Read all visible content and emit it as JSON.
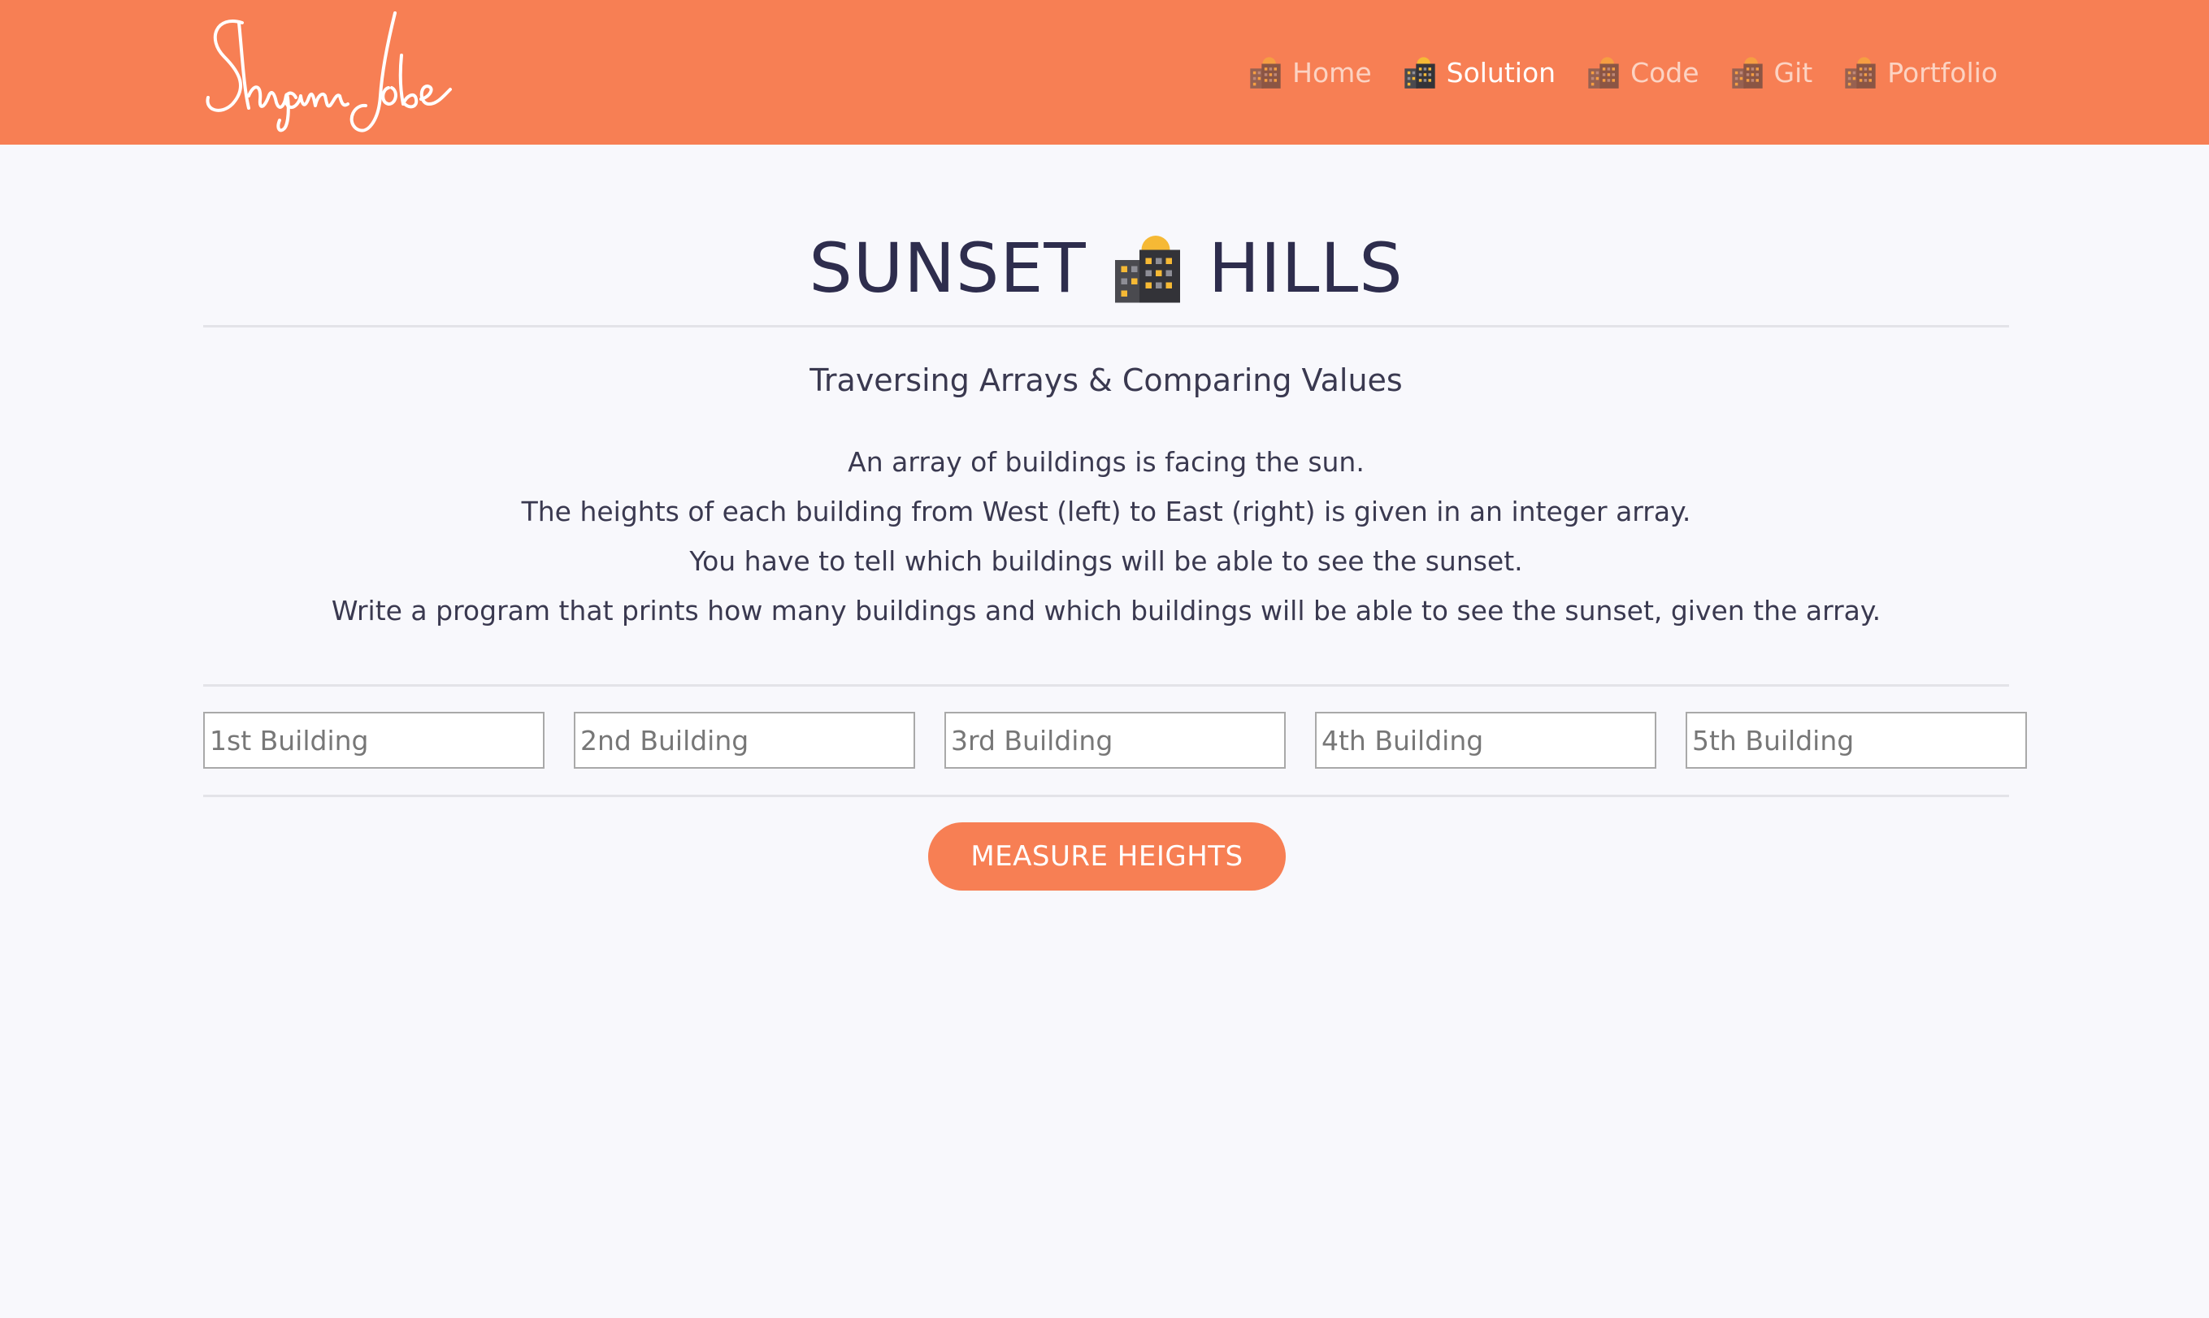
{
  "brand": {
    "logo_alt": "Shyann Jobe"
  },
  "nav": {
    "items": [
      {
        "label": "Home",
        "active": false
      },
      {
        "label": "Solution",
        "active": true
      },
      {
        "label": "Code",
        "active": false
      },
      {
        "label": "Git",
        "active": false
      },
      {
        "label": "Portfolio",
        "active": false
      }
    ]
  },
  "page": {
    "title_left": "SUNSET",
    "title_icon": "city-sunset-icon",
    "title_right": "HILLS",
    "subtitle": "Traversing Arrays & Comparing Values",
    "description": [
      "An array of buildings is facing the sun.",
      "The heights of each building from West (left) to East (right) is given in an integer array.",
      "You have to tell which buildings will be able to see the sunset.",
      "Write a program that prints how many buildings and which buildings will be able to see the sunset, given the array."
    ]
  },
  "inputs": [
    {
      "placeholder": "1st Building",
      "value": ""
    },
    {
      "placeholder": "2nd Building",
      "value": ""
    },
    {
      "placeholder": "3rd Building",
      "value": ""
    },
    {
      "placeholder": "4th Building",
      "value": ""
    },
    {
      "placeholder": "5th Building",
      "value": ""
    }
  ],
  "button": {
    "label": "MEASURE HEIGHTS"
  },
  "colors": {
    "accent": "#f77f54",
    "text": "#2e2d4d",
    "background": "#f8f8fc"
  }
}
